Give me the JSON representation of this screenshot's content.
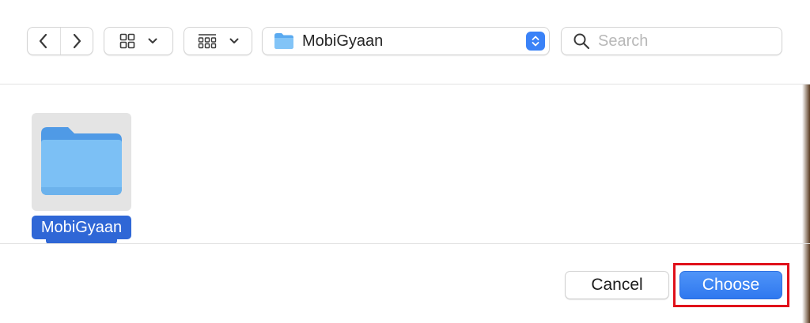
{
  "toolbar": {
    "back_icon": "chevron-left-icon",
    "forward_icon": "chevron-right-icon",
    "icon_view_icon": "grid-icon",
    "group_view_icon": "group-grid-icon",
    "path": {
      "folder_icon": "folder-icon",
      "label": "MobiGyaan",
      "stepper_icon": "up-down-chevron-icon"
    },
    "search": {
      "icon": "magnifier-icon",
      "placeholder": "Search",
      "value": ""
    }
  },
  "files": [
    {
      "name": "MobiGyaan",
      "icon": "folder-icon",
      "selected": true
    }
  ],
  "footer": {
    "cancel_label": "Cancel",
    "choose_label": "Choose"
  },
  "colors": {
    "accent": "#2f67d6",
    "choose_button": "#3a82f7",
    "folder": "#7cc0f5",
    "highlight": "#e0101a"
  }
}
